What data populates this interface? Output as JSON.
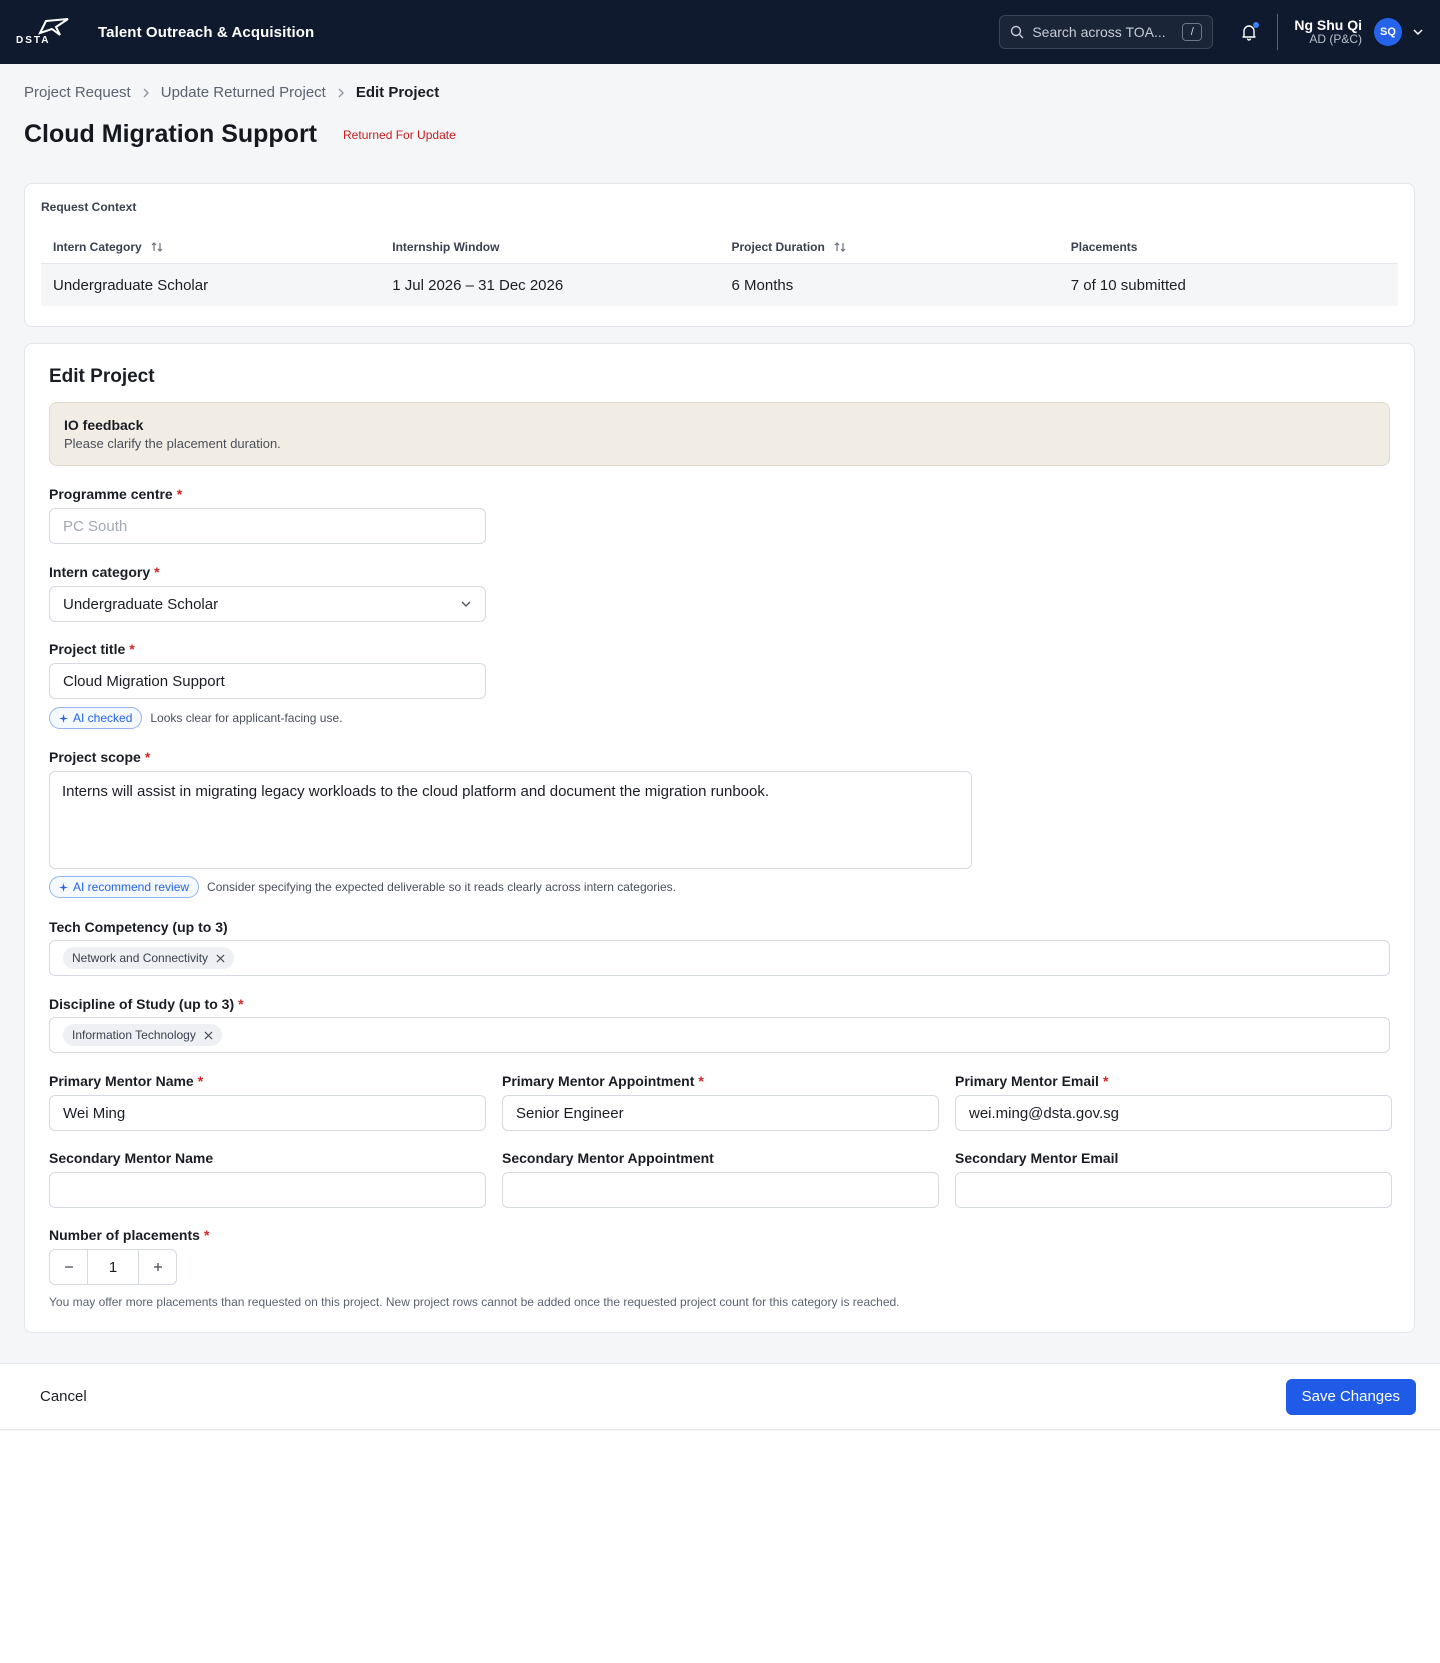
{
  "topbar": {
    "app_title": "Talent Outreach & Acquisition",
    "search_placeholder": "Search across TOA...",
    "search_shortcut": "/",
    "user_name": "Ng Shu Qi",
    "user_role": "AD (P&C)",
    "avatar_initials": "SQ",
    "logo_text": "DSTA"
  },
  "breadcrumb": [
    "Project Request",
    "Update Returned Project",
    "Edit Project"
  ],
  "page": {
    "title": "Cloud Migration Support",
    "status": "Returned For Update"
  },
  "context": {
    "label": "Request Context",
    "headers": [
      "Intern Category",
      "Internship Window",
      "Project Duration",
      "Placements"
    ],
    "row": [
      "Undergraduate Scholar",
      "1 Jul 2026 – 31 Dec 2026",
      "6 Months",
      "7 of 10 submitted"
    ]
  },
  "form": {
    "title": "Edit Project",
    "feedback_title": "IO feedback",
    "feedback_text": "Please clarify the placement duration.",
    "programme_centre_label": "Programme centre",
    "programme_centre_value": "PC South",
    "intern_category_label": "Intern category",
    "intern_category_value": "Undergraduate Scholar",
    "project_title_label": "Project title",
    "project_title_value": "Cloud Migration Support",
    "title_ai_pill": "AI checked",
    "title_ai_text": "Looks clear for applicant-facing use.",
    "project_scope_label": "Project scope",
    "project_scope_value": "Interns will assist in migrating legacy workloads to the cloud platform and document the migration runbook.",
    "scope_ai_pill": "AI recommend review",
    "scope_ai_text": "Consider specifying the expected deliverable so it reads clearly across intern categories.",
    "tech_label": "Tech Competency (up to 3)",
    "tech_tags": [
      "Network and Connectivity"
    ],
    "discipline_label": "Discipline of Study (up to 3)",
    "discipline_tags": [
      "Information Technology"
    ],
    "primary_name_label": "Primary Mentor Name",
    "primary_name_value": "Wei Ming",
    "primary_appt_label": "Primary Mentor Appointment",
    "primary_appt_value": "Senior Engineer",
    "primary_email_label": "Primary Mentor Email",
    "primary_email_value": "wei.ming@dsta.gov.sg",
    "secondary_name_label": "Secondary Mentor Name",
    "secondary_appt_label": "Secondary Mentor Appointment",
    "secondary_email_label": "Secondary Mentor Email",
    "placements_label": "Number of placements",
    "placements_value": "1",
    "placements_helper": "You may offer more placements than requested on this project. New project rows cannot be added once the requested project count for this category is reached.",
    "required_mark": "*"
  },
  "footer": {
    "cancel_label": "Cancel",
    "save_label": "Save Changes"
  },
  "colors": {
    "topbar": "#0f1a2e",
    "accent": "#1f5be6",
    "status": "#c81e1e",
    "feedback_bg": "#f2ede4"
  }
}
